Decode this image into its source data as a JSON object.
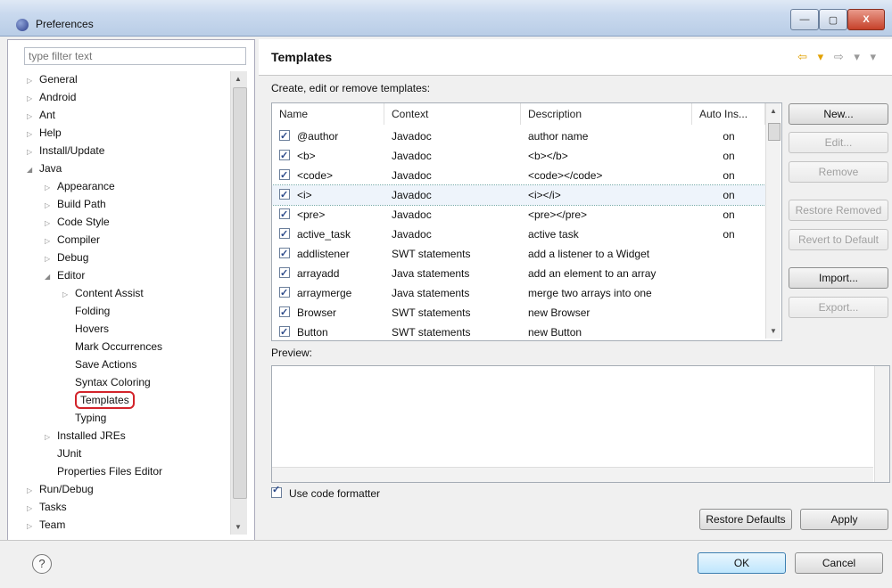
{
  "window": {
    "title": "Preferences",
    "min": "—",
    "max": "▢",
    "close": "X"
  },
  "left": {
    "filter_placeholder": "type filter text",
    "tree": [
      {
        "label": "General",
        "level": 0,
        "tw": "▷"
      },
      {
        "label": "Android",
        "level": 0,
        "tw": "▷"
      },
      {
        "label": "Ant",
        "level": 0,
        "tw": "▷"
      },
      {
        "label": "Help",
        "level": 0,
        "tw": "▷"
      },
      {
        "label": "Install/Update",
        "level": 0,
        "tw": "▷"
      },
      {
        "label": "Java",
        "level": 0,
        "tw": "◢"
      },
      {
        "label": "Appearance",
        "level": 1,
        "tw": "▷"
      },
      {
        "label": "Build Path",
        "level": 1,
        "tw": "▷"
      },
      {
        "label": "Code Style",
        "level": 1,
        "tw": "▷"
      },
      {
        "label": "Compiler",
        "level": 1,
        "tw": "▷"
      },
      {
        "label": "Debug",
        "level": 1,
        "tw": "▷"
      },
      {
        "label": "Editor",
        "level": 1,
        "tw": "◢"
      },
      {
        "label": "Content Assist",
        "level": 2,
        "tw": "▷"
      },
      {
        "label": "Folding",
        "level": 2,
        "tw": ""
      },
      {
        "label": "Hovers",
        "level": 2,
        "tw": ""
      },
      {
        "label": "Mark Occurrences",
        "level": 2,
        "tw": ""
      },
      {
        "label": "Save Actions",
        "level": 2,
        "tw": ""
      },
      {
        "label": "Syntax Coloring",
        "level": 2,
        "tw": ""
      },
      {
        "label": "Templates",
        "level": 2,
        "tw": "",
        "highlight": true
      },
      {
        "label": "Typing",
        "level": 2,
        "tw": ""
      },
      {
        "label": "Installed JREs",
        "level": 1,
        "tw": "▷"
      },
      {
        "label": "JUnit",
        "level": 1,
        "tw": ""
      },
      {
        "label": "Properties Files Editor",
        "level": 1,
        "tw": ""
      },
      {
        "label": "Run/Debug",
        "level": 0,
        "tw": "▷"
      },
      {
        "label": "Tasks",
        "level": 0,
        "tw": "▷"
      },
      {
        "label": "Team",
        "level": 0,
        "tw": "▷"
      }
    ]
  },
  "page": {
    "title": "Templates",
    "nav_back": "⇦ ▾",
    "nav_fwd": "⇨ ▾ ▾",
    "caption": "Create, edit or remove templates:",
    "columns": [
      "Name",
      "Context",
      "Description",
      "Auto Ins..."
    ],
    "rows": [
      {
        "name": "@author",
        "context": "Javadoc",
        "description": "author name",
        "auto": "on"
      },
      {
        "name": "<b>",
        "context": "Javadoc",
        "description": "<b></b>",
        "auto": "on"
      },
      {
        "name": "<code>",
        "context": "Javadoc",
        "description": "<code></code>",
        "auto": "on"
      },
      {
        "name": "<i>",
        "context": "Javadoc",
        "description": "<i></i>",
        "auto": "on",
        "selected": true
      },
      {
        "name": "<pre>",
        "context": "Javadoc",
        "description": "<pre></pre>",
        "auto": "on"
      },
      {
        "name": "active_task",
        "context": "Javadoc",
        "description": "active task",
        "auto": "on"
      },
      {
        "name": "addlistener",
        "context": "SWT statements",
        "description": "add a listener to a Widget",
        "auto": ""
      },
      {
        "name": "arrayadd",
        "context": "Java statements",
        "description": "add an element to an array",
        "auto": ""
      },
      {
        "name": "arraymerge",
        "context": "Java statements",
        "description": "merge two arrays into one",
        "auto": ""
      },
      {
        "name": "Browser",
        "context": "SWT statements",
        "description": "new Browser",
        "auto": ""
      },
      {
        "name": "Button",
        "context": "SWT statements",
        "description": "new Button",
        "auto": ""
      }
    ],
    "buttons": {
      "new": "New...",
      "edit": "Edit...",
      "remove": "Remove",
      "restore_removed": "Restore Removed",
      "revert_default": "Revert to Default",
      "import": "Import...",
      "export": "Export..."
    },
    "preview_label": "Preview:",
    "use_formatter": "Use code formatter",
    "restore_defaults": "Restore Defaults",
    "apply": "Apply"
  },
  "footer": {
    "help": "?",
    "ok": "OK",
    "cancel": "Cancel"
  }
}
